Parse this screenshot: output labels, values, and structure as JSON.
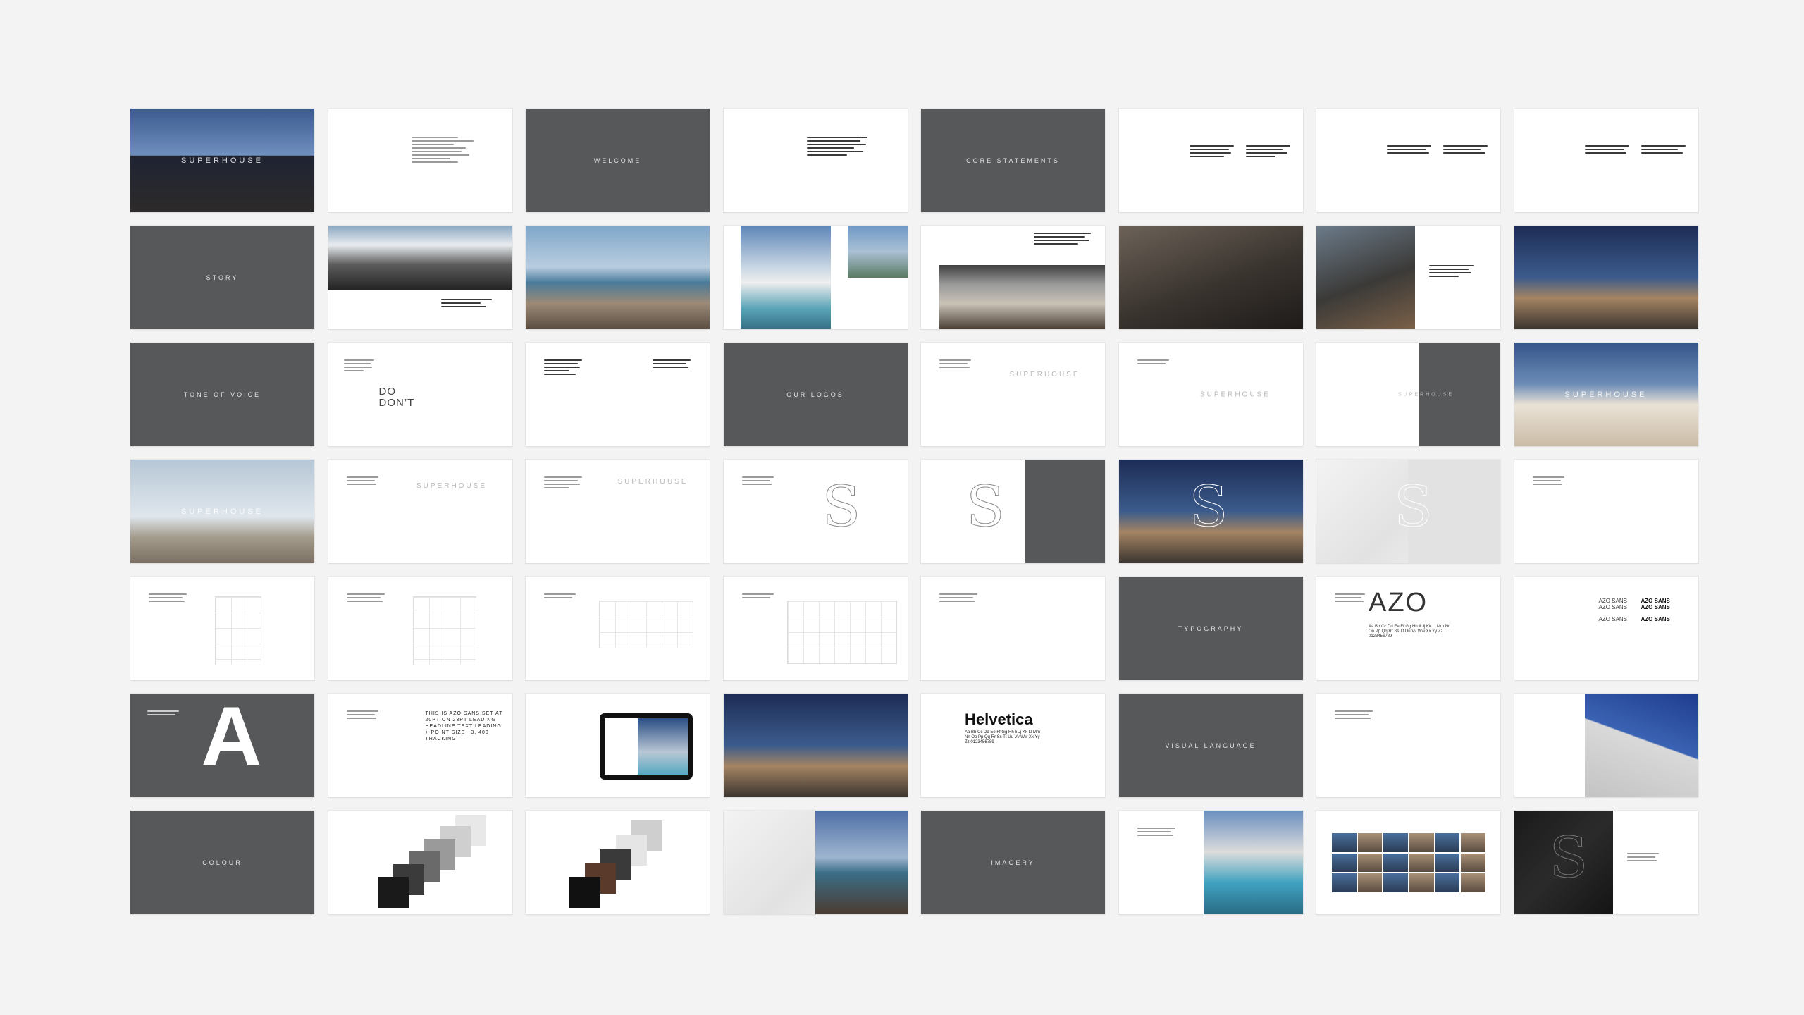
{
  "slides": [
    {
      "title": "SUPERHOUSE"
    },
    {
      "title": ""
    },
    {
      "title": "WELCOME"
    },
    {
      "title": ""
    },
    {
      "title": "CORE STATEMENTS"
    },
    {
      "title": ""
    },
    {
      "title": ""
    },
    {
      "title": ""
    },
    {
      "title": "STORY"
    },
    {
      "title": ""
    },
    {
      "title": ""
    },
    {
      "title": ""
    },
    {
      "title": ""
    },
    {
      "title": ""
    },
    {
      "title": ""
    },
    {
      "title": ""
    },
    {
      "title": "TONE OF VOICE"
    },
    {
      "title": "DO\nDON’T"
    },
    {
      "title": ""
    },
    {
      "title": "OUR LOGOS"
    },
    {
      "title": "SUPERHOUSE"
    },
    {
      "title": "SUPERHOUSE"
    },
    {
      "title": "SUPERHOUSE"
    },
    {
      "title": "SUPERHOUSE"
    },
    {
      "title": "SUPERHOUSE"
    },
    {
      "title": "SUPERHOUSE"
    },
    {
      "title": "SUPERHOUSE"
    },
    {
      "title": "S"
    },
    {
      "title": "S"
    },
    {
      "title": "S"
    },
    {
      "title": "S"
    },
    {
      "title": ""
    },
    {
      "title": ""
    },
    {
      "title": ""
    },
    {
      "title": ""
    },
    {
      "title": ""
    },
    {
      "title": ""
    },
    {
      "title": "TYPOGRAPHY"
    },
    {
      "title": "AZO"
    },
    {
      "title": "AZO SANS"
    },
    {
      "title": "A"
    },
    {
      "title": "THIS IS AZO SANS SET AT 20PT ON 23PT LEADING HEADLINE TEXT LEADING + POINT SIZE +3, 400 TRACKING"
    },
    {
      "title": ""
    },
    {
      "title": ""
    },
    {
      "title": "Helvetica"
    },
    {
      "title": "VISUAL LANGUAGE"
    },
    {
      "title": ""
    },
    {
      "title": ""
    },
    {
      "title": "COLOUR"
    },
    {
      "title": ""
    },
    {
      "title": ""
    },
    {
      "title": ""
    },
    {
      "title": "IMAGERY"
    },
    {
      "title": ""
    },
    {
      "title": ""
    },
    {
      "title": "S"
    }
  ],
  "helvetica_sample": "Aa Bb Cc Dd Ee Ff Gg Hh Ii Jj Kk Ll Mm Nn Oo Pp Qq Rr Ss Tt Uu Vv Ww Xx Yy Zz 0123456789",
  "azo_sample": "Aa Bb Cc Dd Ee Ff Gg Hh Ii Jj Kk Ll Mm Nn Oo Pp Qq Rr Ss Tt Uu Vv Ww Xx Yy Zz 0123456789",
  "azo_variants": [
    "AZO SANS",
    "AZO SANS",
    "AZO SANS",
    "AZO SANS",
    "AZO SANS",
    "AZO SANS"
  ],
  "colors": {
    "background": "#f3f3f3",
    "slide_dark": "#57585a",
    "slide_light": "#ffffff"
  }
}
